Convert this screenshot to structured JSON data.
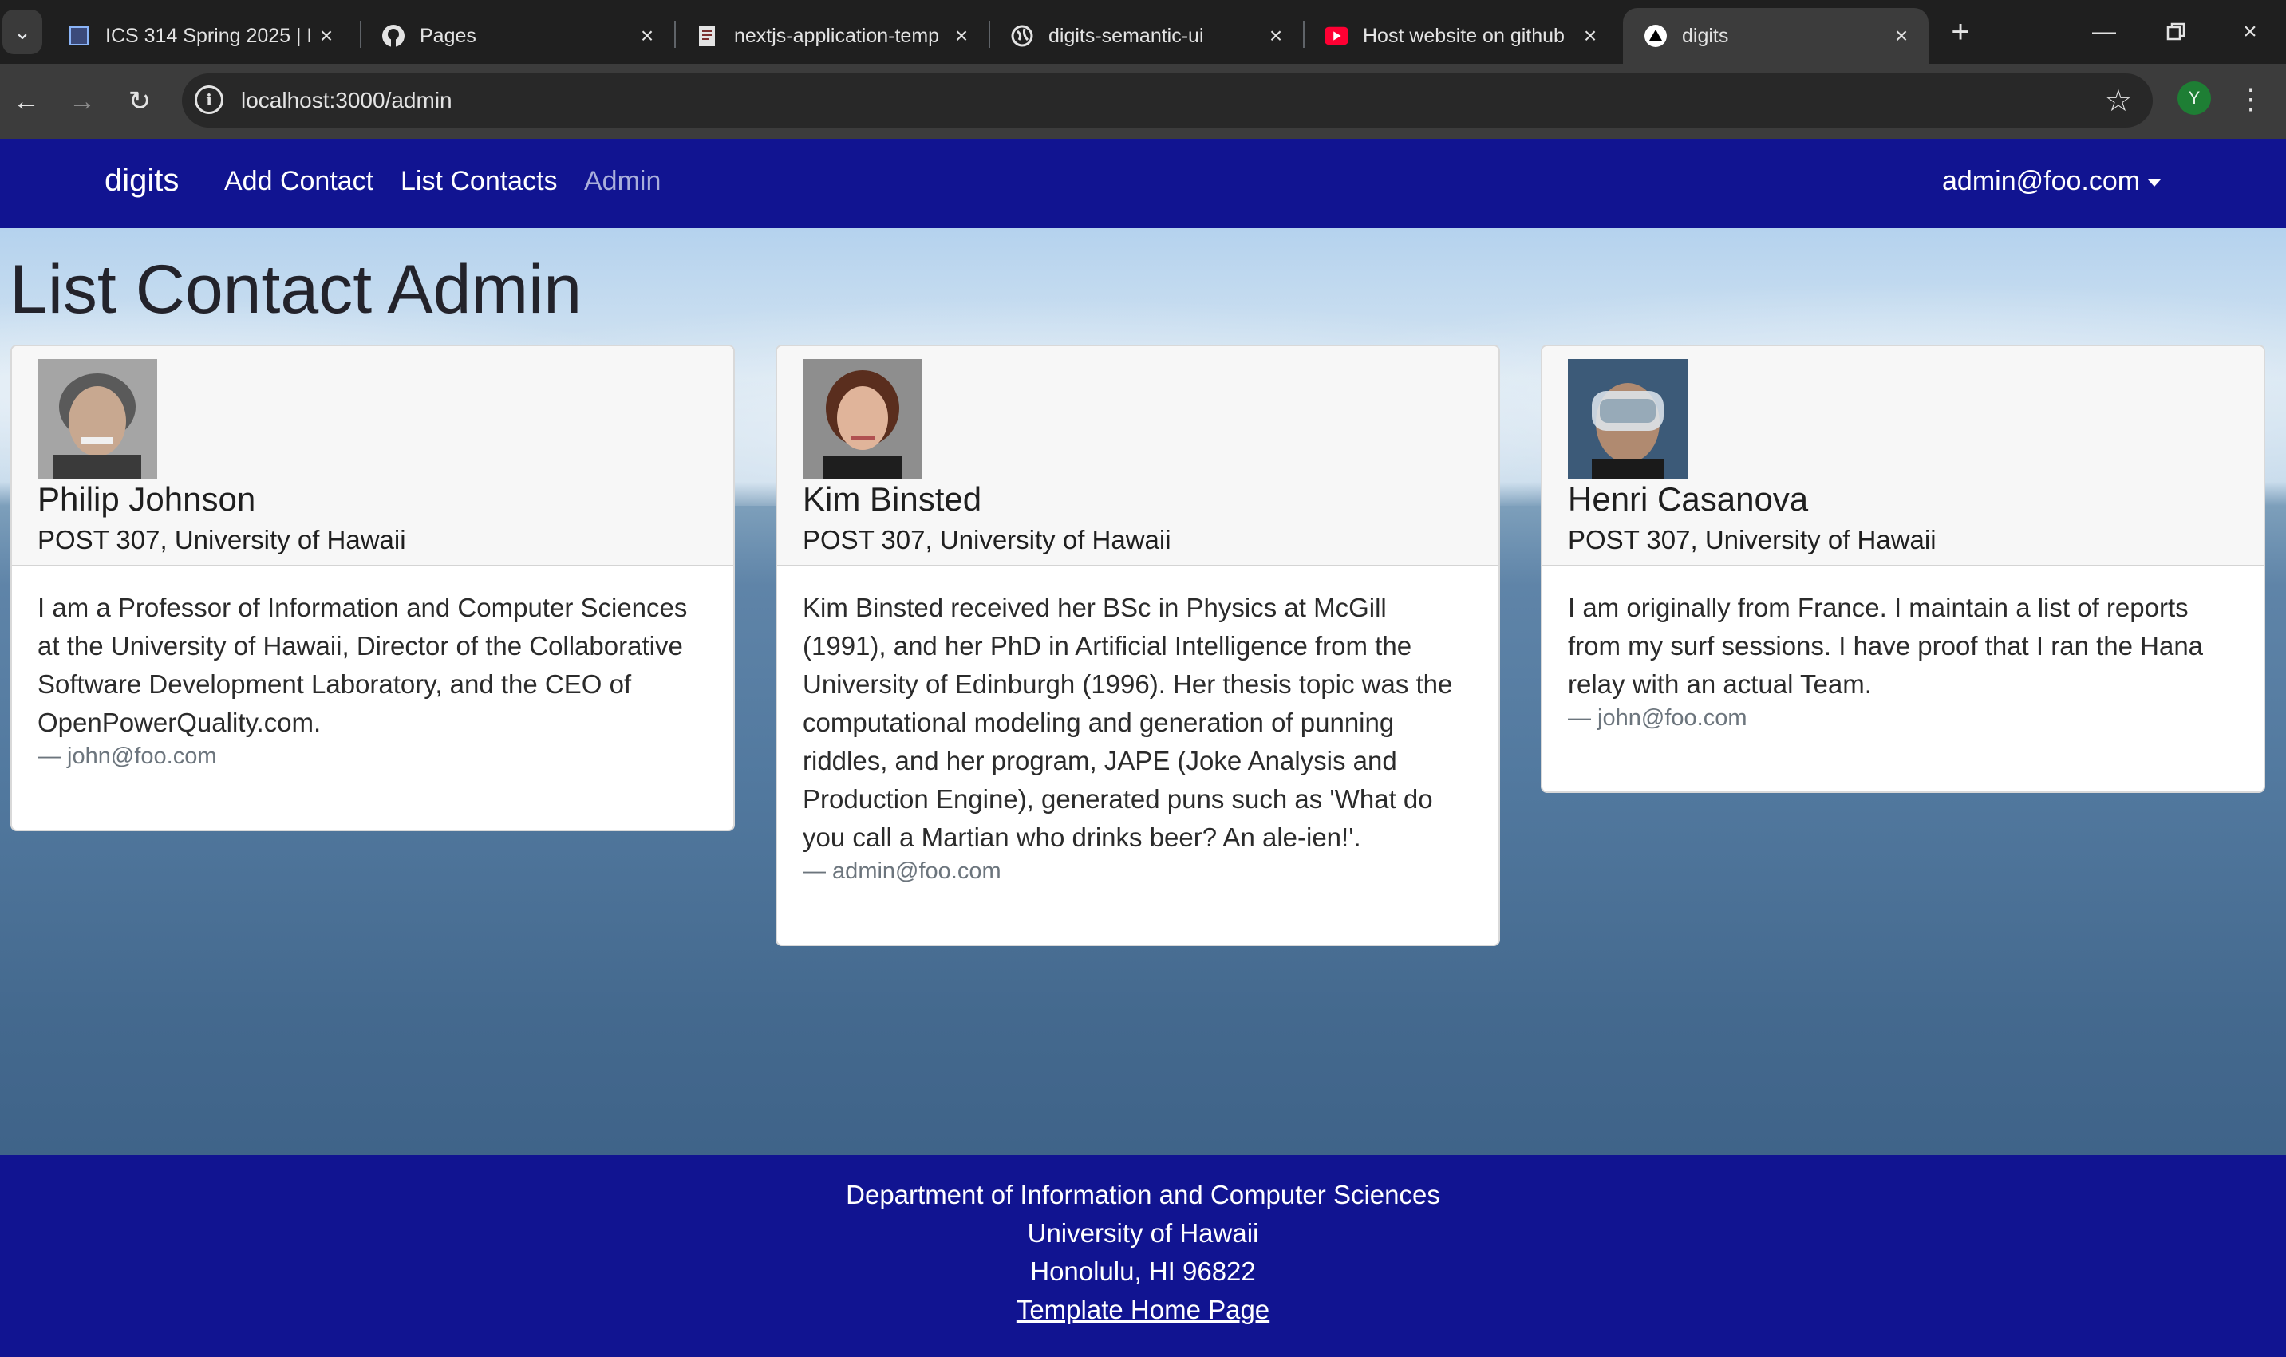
{
  "browser": {
    "tabs": [
      {
        "title": "ICS 314 Spring 2025 | ESI",
        "icon": "page-icon"
      },
      {
        "title": "Pages",
        "icon": "github-icon"
      },
      {
        "title": "nextjs-application-temp",
        "icon": "document-icon"
      },
      {
        "title": "digits-semantic-ui",
        "icon": "globe-icon"
      },
      {
        "title": "Host website on github",
        "icon": "youtube-icon"
      },
      {
        "title": "digits",
        "icon": "vercel-icon"
      }
    ],
    "url": "localhost:3000/admin",
    "profile_initial": "Y"
  },
  "navbar": {
    "brand": "digits",
    "links": [
      "Add Contact",
      "List Contacts",
      "Admin"
    ],
    "user": "admin@foo.com"
  },
  "page": {
    "heading": "List Contact Admin"
  },
  "contacts": [
    {
      "name": "Philip Johnson",
      "address": "POST 307, University of Hawaii",
      "description": "I am a Professor of Information and Computer Sciences at the University of Hawaii, Director of the Collaborative Software Development Laboratory, and the CEO of OpenPowerQuality.com.",
      "owner": "— john@foo.com"
    },
    {
      "name": "Kim Binsted",
      "address": "POST 307, University of Hawaii",
      "description": "Kim Binsted received her BSc in Physics at McGill (1991), and her PhD in Artificial Intelligence from the University of Edinburgh (1996). Her thesis topic was the computational modeling and generation of punning riddles, and her program, JAPE (Joke Analysis and Production Engine), generated puns such as 'What do you call a Martian who drinks beer? An ale-ien!'.",
      "owner": "— admin@foo.com"
    },
    {
      "name": "Henri Casanova",
      "address": "POST 307, University of Hawaii",
      "description": "I am originally from France. I maintain a list of reports from my surf sessions. I have proof that I ran the Hana relay with an actual Team.",
      "owner": "— john@foo.com"
    }
  ],
  "footer": {
    "lines": [
      "Department of Information and Computer Sciences",
      "University of Hawaii",
      "Honolulu, HI 96822"
    ],
    "link": "Template Home Page"
  },
  "colors": {
    "navbar": "#111491",
    "footer": "#111491"
  }
}
